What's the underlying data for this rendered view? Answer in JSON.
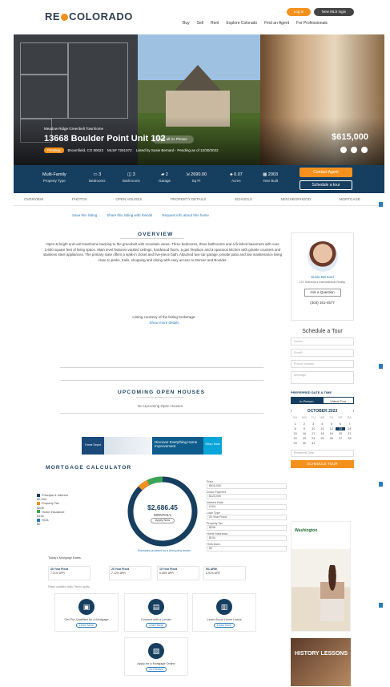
{
  "header": {
    "logo_left": "RE",
    "logo_right": "COLORADO",
    "login_label": "Log in",
    "new_user_label": "New MLS login",
    "nav": [
      "Buy",
      "Sell",
      "Rent",
      "Explore Colorado",
      "Find an Agent",
      "For Professionals"
    ]
  },
  "hero": {
    "address_sub": "Meadow Ridge Greenbelt Townhome",
    "address": "13668 Boulder Point Unit 102",
    "see_photos": "See all 31 Photos",
    "status_badge": "Pending",
    "city": "Broomfield, CO 80023",
    "mls": "MLS# 7261972",
    "listed_by": "Listed by Susie Bernard - Pending as of 12/30/2022",
    "price": "$615,000"
  },
  "stats": [
    {
      "value": "Multi-Family",
      "label": "Property Type"
    },
    {
      "value": "3",
      "label": "Bedrooms",
      "icon": "bed-icon"
    },
    {
      "value": "3",
      "label": "Bathrooms",
      "icon": "bath-icon"
    },
    {
      "value": "2",
      "label": "Garage",
      "icon": "car-icon"
    },
    {
      "value": "2690.00",
      "label": "Sq Ft",
      "icon": "ruler-icon"
    },
    {
      "value": "0.07",
      "label": "Acres",
      "icon": "tree-icon"
    },
    {
      "value": "2003",
      "label": "Year Built",
      "icon": "calendar-icon"
    }
  ],
  "buttons": {
    "contact": "Contact Agent",
    "tour": "Schedule a tour"
  },
  "subtabs": [
    "OVERVIEW",
    "PHOTOS",
    "OPEN HOUSES",
    "PROPERTY DETAILS",
    "SCHOOLS",
    "NEIGHBORHOOD",
    "MORTGAGE"
  ],
  "links": [
    "Save this listing",
    "Share this listing with friends",
    "Request info about this home"
  ],
  "overview": {
    "title": "OVERVIEW",
    "body": "Open & bright end-unit townhome backing to the greenbelt with mountain views. Three bedrooms, three bathrooms and a finished basement with over 2,600 square feet of living space. Main level features vaulted ceilings, hardwood floors, a gas fireplace and a spacious kitchen with granite counters and stainless steel appliances. The primary suite offers a walk-in closet and five-piece bath. Attached two-car garage, private patio and low maintenance living close to parks, trails, shopping and dining with easy access to Denver and Boulder.",
    "note_line1": "Listing courtesy of the listing brokerage.",
    "note_line2": "Show more details"
  },
  "agent": {
    "name": "Susie Bernard",
    "company": "LIV Sotheby's International Realty",
    "ask_label": "Ask a Question",
    "phone": "(303) 161-4577"
  },
  "schedule": {
    "title": "Schedule a Tour",
    "fields": [
      "Name*",
      "Email*",
      "Phone Number",
      "Message"
    ],
    "pref_label": "PREFERRED DATE & TIME",
    "in_person": "In-Person",
    "virtual": "Virtual Tour",
    "month": "OCTOBER 2023",
    "days_hdr": [
      "SU",
      "MO",
      "TU",
      "WE",
      "TH",
      "FR",
      "SA"
    ],
    "days": [
      "",
      "",
      "",
      "",
      "",
      "",
      "",
      "1",
      "2",
      "3",
      "4",
      "5",
      "6",
      "7",
      "8",
      "9",
      "10",
      "11",
      "12",
      "13",
      "14",
      "15",
      "16",
      "17",
      "18",
      "19",
      "20",
      "21",
      "22",
      "23",
      "24",
      "25",
      "26",
      "27",
      "28",
      "29",
      "30",
      "31"
    ],
    "selected_day": "13",
    "time_placeholder": "Preferred Time",
    "submit": "SCHEDULE TOUR"
  },
  "open_houses": {
    "title": "UPCOMING OPEN HOUSES",
    "empty": "No Upcoming Open Houses"
  },
  "banner": {
    "brand": "Home Depot",
    "headline": "Discover Everything Home Improvement",
    "cta": "Shop Now"
  },
  "mortgage": {
    "title": "MORTGAGE CALCULATOR",
    "legend": [
      {
        "label": "Principal & Interest",
        "value": "$2,344",
        "color": "#163e5f"
      },
      {
        "label": "Property Tax",
        "value": "$208",
        "color": "#f4911e"
      },
      {
        "label": "Home Insurance",
        "value": "$134",
        "color": "#3aa655"
      },
      {
        "label": "HOA",
        "value": "$0",
        "color": "#2b7ab8"
      }
    ],
    "monthly": "$2,686.45",
    "monthly_label": "MONTHLY",
    "apply_btn": "Apply Now",
    "note": "Estimates provided by a third-party lender",
    "form_labels": [
      "Price",
      "Down Payment",
      "Interest Rate",
      "Loan Type",
      "Property Tax",
      "Home Insurance",
      "HOA Dues"
    ],
    "form_values": [
      "$615,000",
      "$123,000",
      "6.5%",
      "30 Year Fixed",
      "$208",
      "$134",
      "$0"
    ],
    "rates_title": "Today's Mortgage Rates",
    "rates": [
      {
        "name": "30 Year Fixed",
        "rate": "7.21% APR"
      },
      {
        "name": "20 Year Fixed",
        "rate": "7.12% APR"
      },
      {
        "name": "15 Year Fixed",
        "rate": "6.48% APR"
      },
      {
        "name": "5/1 ARM",
        "rate": "6.91% APR"
      }
    ],
    "rates_foot": "Rates updated daily. Terms apply."
  },
  "tools": [
    {
      "title": "Get Pre-Qualified for a Mortgage",
      "btn": "Learn More",
      "icon": "calculator-icon"
    },
    {
      "title": "Connect with a Lender",
      "btn": "Learn More",
      "icon": "bank-icon"
    },
    {
      "title": "Learn About Home Loans",
      "btn": "Learn More",
      "icon": "book-icon"
    },
    {
      "title": "Apply for a Mortgage Online",
      "btn": "Get Started",
      "icon": "document-icon"
    }
  ],
  "ads": {
    "washington": "Washington",
    "history": "HISTORY LESSONS"
  }
}
